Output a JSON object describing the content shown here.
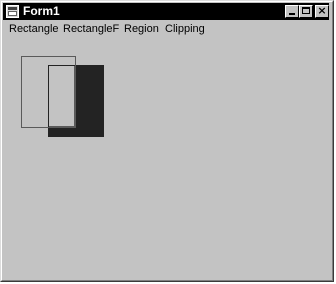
{
  "window": {
    "title": "Form1"
  },
  "menu": {
    "items": [
      {
        "label": "Rectangle"
      },
      {
        "label": "RectangleF"
      },
      {
        "label": "Region"
      },
      {
        "label": "Clipping"
      }
    ]
  },
  "colors": {
    "titlebar": "#000000",
    "face": "#c3c3c3",
    "filled_rect": "#232323",
    "outline_rect": "#5a5a5a"
  },
  "icons": {
    "app": "form-window-icon",
    "minimize": "minimize-icon",
    "maximize": "maximize-icon",
    "close": "close-icon"
  }
}
